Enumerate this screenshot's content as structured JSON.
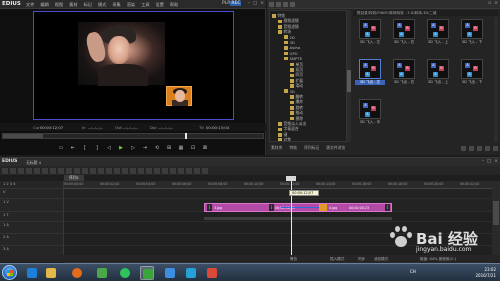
{
  "app": {
    "name": "EDIUS"
  },
  "player": {
    "menu": [
      "文件",
      "编辑",
      "视图",
      "素材",
      "标记",
      "模式",
      "采集",
      "渲染",
      "工具",
      "设置",
      "帮助"
    ],
    "pl_label": "PLR",
    "rec_label": "REC",
    "tc_cur_label": "Cur",
    "tc_cur": "00:00:12;07",
    "tc_in_label": "In",
    "tc_in": "--:--:--;--",
    "tc_out_label": "Out",
    "tc_out": "--:--:--;--",
    "tc_dur_label": "Dur",
    "tc_dur": "--:--:--;--",
    "tc_ttl_label": "Ttl",
    "tc_ttl": "00:00:13;04",
    "transport": [
      "▭",
      "⇤",
      "[",
      "]",
      "◁",
      "▶",
      "▷",
      "⇥",
      "⟲",
      "⊞",
      "▦",
      "⊡",
      "⊠"
    ]
  },
  "bin": {
    "path": "根目录/特效/FINNT/转场特效 - 3 D/转场-3D/二维",
    "tree": [
      "特效",
      "视频滤镜",
      "音频滤镜",
      "转场",
      "2D",
      "3D",
      "Alpha",
      "GPU",
      "SMPTE",
      "单页",
      "双页",
      "四页",
      "扩展",
      "滑动",
      "3D",
      "翻转",
      "爆炸",
      "旋转",
      "推动",
      "擦除",
      "音频淡入淡出",
      "字幕混合",
      "键",
      "对焦"
    ],
    "clips": [
      {
        "label": "3D 飞入 - 左",
        "selected": false
      },
      {
        "label": "3D 飞入 - 右",
        "selected": false
      },
      {
        "label": "3D 飞入 - 上",
        "selected": false
      },
      {
        "label": "3D 飞入 - 下",
        "selected": false
      },
      {
        "label": "3D 飞出 - 左",
        "selected": true
      },
      {
        "label": "3D 飞出 - 右",
        "selected": false
      },
      {
        "label": "3D 飞出 - 上",
        "selected": false
      },
      {
        "label": "3D 飞出 - 下",
        "selected": false
      },
      {
        "label": "3D 飞入 - 中",
        "selected": false
      }
    ],
    "tabs": [
      "素材库",
      "特效",
      "序列标记",
      "源文件浏览"
    ]
  },
  "timeline": {
    "project": "无标题 4",
    "sequence_tab": "序列1",
    "tracks": [
      {
        "name": "1 2 3 4",
        "kind": "header"
      },
      {
        "name": "V",
        "kind": "video"
      },
      {
        "name": "1 V",
        "kind": "video"
      },
      {
        "name": "1 T",
        "kind": "title"
      },
      {
        "name": "1 A",
        "kind": "audio"
      },
      {
        "name": "2 A",
        "kind": "audio"
      },
      {
        "name": "3 A",
        "kind": "audio"
      }
    ],
    "ruler_ticks": [
      "00:00:00;00",
      "00:00:02;00",
      "00:00:04;00",
      "00:00:06;00",
      "00:00:08;00",
      "00:00:10;00",
      "00:00:12;00",
      "00:00:14;00",
      "00:00:16;00",
      "00:00:18;00",
      "00:00:20;00",
      "00:00:22;00"
    ],
    "clip_labels": [
      "3.jpg",
      "00;00;00;05",
      "4.jpg",
      "00;00;00;23"
    ],
    "tooltip_tc": "00:00:12;07",
    "status": [
      "警告",
      "插入模式",
      "同步",
      "波纹模式",
      "磁盘: 84% 被使用(C:)"
    ]
  },
  "taskbar": {
    "lang": "CH",
    "time": "23:02",
    "date": "2016/7/21"
  },
  "watermark": {
    "brand": "Bai 经验",
    "url": "jingyan.baidu.com"
  },
  "colors": {
    "clip": "#b44aa8",
    "accent": "#3b63b8",
    "play": "#6fcf4a"
  }
}
